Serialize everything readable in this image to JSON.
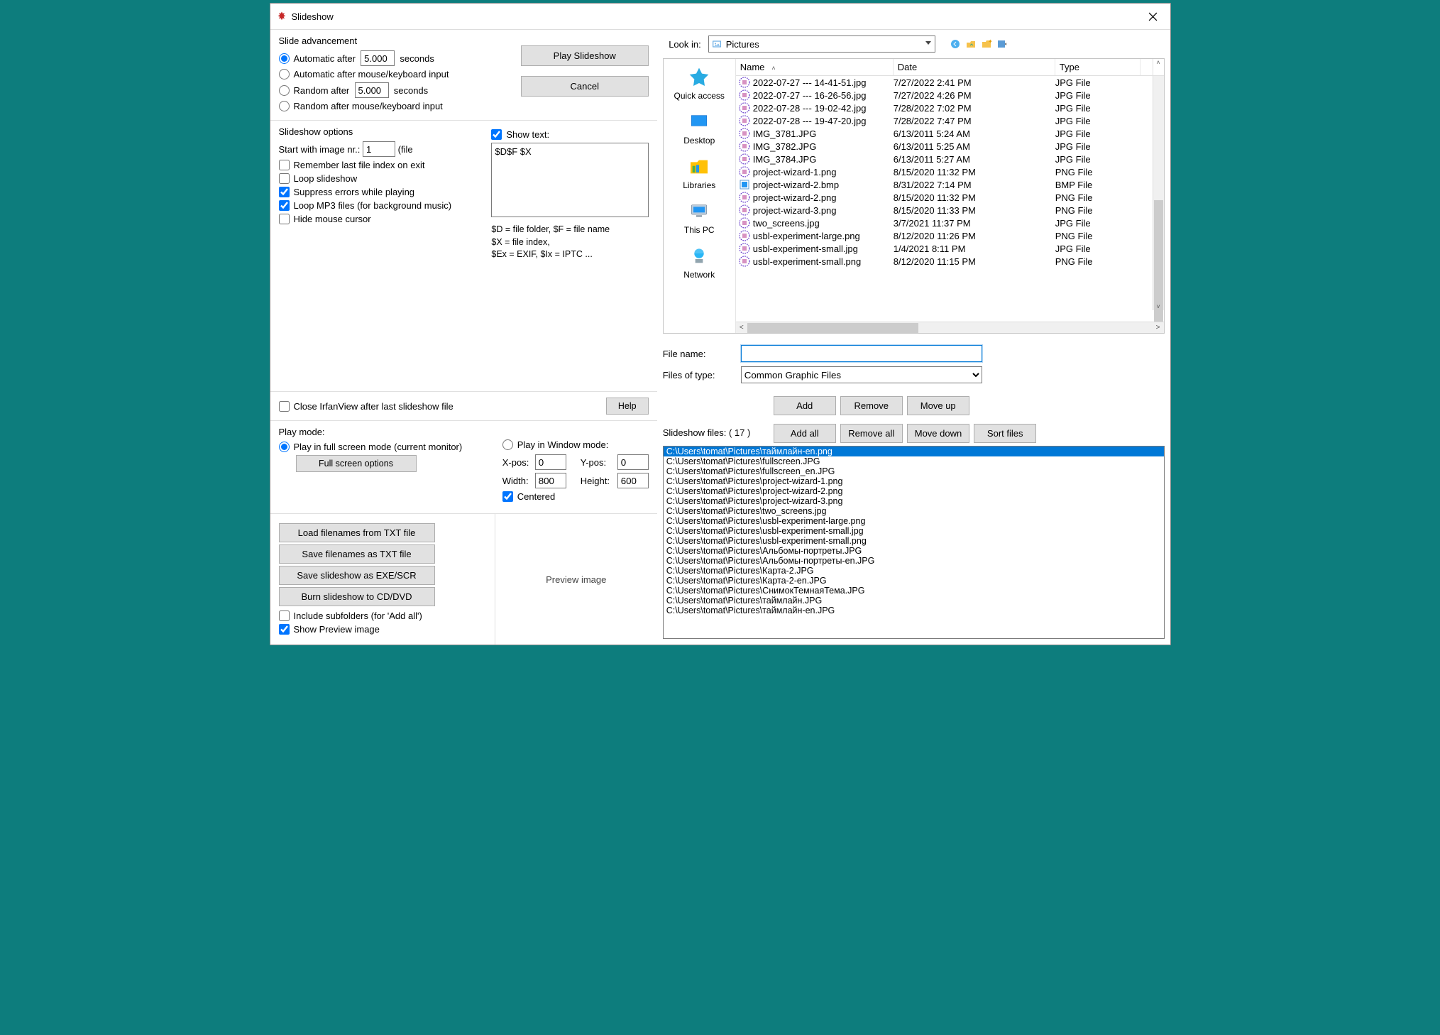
{
  "window_title": "Slideshow",
  "advancement": {
    "title": "Slide advancement",
    "auto_after": "Automatic after",
    "auto_after_sec": "5.000",
    "seconds": "seconds",
    "auto_input": "Automatic after mouse/keyboard input",
    "random_after": "Random   after",
    "random_after_sec": "5.000",
    "random_input": "Random   after mouse/keyboard input"
  },
  "buttons": {
    "play": "Play Slideshow",
    "cancel": "Cancel",
    "help": "Help"
  },
  "options": {
    "title": "Slideshow options",
    "start_nr_label": "Start with image nr.:",
    "start_nr": "1",
    "file_suffix": "(file",
    "remember": "Remember last file index on exit",
    "loop": "Loop slideshow",
    "suppress": "Suppress errors while playing",
    "loop_mp3": "Loop MP3 files (for background music)",
    "hide_cursor": "Hide mouse cursor",
    "show_text": "Show text:",
    "text_pattern": "$D$F $X",
    "hint1": "$D = file folder, $F = file name",
    "hint2": "$X = file index,",
    "hint3": "$Ex = EXIF, $Ix = IPTC ..."
  },
  "close_after": "Close IrfanView after last slideshow file",
  "playmode": {
    "title": "Play mode:",
    "full": "Play in full screen mode (current monitor)",
    "full_btn": "Full screen options",
    "window": "Play in Window mode:",
    "xpos_l": "X-pos:",
    "xpos": "0",
    "ypos_l": "Y-pos:",
    "ypos": "0",
    "width_l": "Width:",
    "width": "800",
    "height_l": "Height:",
    "height": "600",
    "centered": "Centered"
  },
  "fileops": {
    "load_txt": "Load filenames from TXT file",
    "save_txt": "Save filenames as TXT file",
    "save_exe": "Save slideshow as  EXE/SCR",
    "burn": "Burn slideshow to CD/DVD",
    "include_sub": "Include subfolders (for 'Add all')",
    "show_preview": "Show Preview image",
    "preview_label": "Preview image"
  },
  "lookin": {
    "label": "Look in:",
    "value": "Pictures"
  },
  "headers": {
    "name": "Name",
    "date": "Date",
    "type": "Type"
  },
  "files": [
    {
      "name": "2022-07-27 --- 14-41-51.jpg",
      "date": "7/27/2022 2:41 PM",
      "type": "JPG File",
      "ic": "img"
    },
    {
      "name": "2022-07-27 --- 16-26-56.jpg",
      "date": "7/27/2022 4:26 PM",
      "type": "JPG File",
      "ic": "img"
    },
    {
      "name": "2022-07-28 --- 19-02-42.jpg",
      "date": "7/28/2022 7:02 PM",
      "type": "JPG File",
      "ic": "img"
    },
    {
      "name": "2022-07-28 --- 19-47-20.jpg",
      "date": "7/28/2022 7:47 PM",
      "type": "JPG File",
      "ic": "img"
    },
    {
      "name": "IMG_3781.JPG",
      "date": "6/13/2011 5:24 AM",
      "type": "JPG File",
      "ic": "img"
    },
    {
      "name": "IMG_3782.JPG",
      "date": "6/13/2011 5:25 AM",
      "type": "JPG File",
      "ic": "img"
    },
    {
      "name": "IMG_3784.JPG",
      "date": "6/13/2011 5:27 AM",
      "type": "JPG File",
      "ic": "img"
    },
    {
      "name": "project-wizard-1.png",
      "date": "8/15/2020 11:32 PM",
      "type": "PNG File",
      "ic": "img"
    },
    {
      "name": "project-wizard-2.bmp",
      "date": "8/31/2022 7:14 PM",
      "type": "BMP File",
      "ic": "bmp"
    },
    {
      "name": "project-wizard-2.png",
      "date": "8/15/2020 11:32 PM",
      "type": "PNG File",
      "ic": "img"
    },
    {
      "name": "project-wizard-3.png",
      "date": "8/15/2020 11:33 PM",
      "type": "PNG File",
      "ic": "img"
    },
    {
      "name": "two_screens.jpg",
      "date": "3/7/2021 11:37 PM",
      "type": "JPG File",
      "ic": "img"
    },
    {
      "name": "usbl-experiment-large.png",
      "date": "8/12/2020 11:26 PM",
      "type": "PNG File",
      "ic": "img"
    },
    {
      "name": "usbl-experiment-small.jpg",
      "date": "1/4/2021 8:11 PM",
      "type": "JPG File",
      "ic": "img"
    },
    {
      "name": "usbl-experiment-small.png",
      "date": "8/12/2020 11:15 PM",
      "type": "PNG File",
      "ic": "img"
    }
  ],
  "filename_label": "File name:",
  "filename_value": "",
  "filetype_label": "Files of type:",
  "filetype_value": "Common Graphic Files",
  "sfbtn": {
    "add": "Add",
    "remove": "Remove",
    "moveup": "Move up",
    "addall": "Add all",
    "removeall": "Remove all",
    "movedown": "Move down",
    "sort": "Sort files"
  },
  "sf_header": "Slideshow files:  ( 17 )",
  "sf_items": [
    "C:\\Users\\tomat\\Pictures\\таймлайн-en.png",
    "C:\\Users\\tomat\\Pictures\\fullscreen.JPG",
    "C:\\Users\\tomat\\Pictures\\fullscreen_en.JPG",
    "C:\\Users\\tomat\\Pictures\\project-wizard-1.png",
    "C:\\Users\\tomat\\Pictures\\project-wizard-2.png",
    "C:\\Users\\tomat\\Pictures\\project-wizard-3.png",
    "C:\\Users\\tomat\\Pictures\\two_screens.jpg",
    "C:\\Users\\tomat\\Pictures\\usbl-experiment-large.png",
    "C:\\Users\\tomat\\Pictures\\usbl-experiment-small.jpg",
    "C:\\Users\\tomat\\Pictures\\usbl-experiment-small.png",
    "C:\\Users\\tomat\\Pictures\\Альбомы-портреты.JPG",
    "C:\\Users\\tomat\\Pictures\\Альбомы-портреты-en.JPG",
    "C:\\Users\\tomat\\Pictures\\Карта-2.JPG",
    "C:\\Users\\tomat\\Pictures\\Карта-2-en.JPG",
    "C:\\Users\\tomat\\Pictures\\СнимокТемнаяТема.JPG",
    "C:\\Users\\tomat\\Pictures\\таймлайн.JPG",
    "C:\\Users\\tomat\\Pictures\\таймлайн-en.JPG"
  ],
  "places": {
    "quick": "Quick access",
    "desktop": "Desktop",
    "libraries": "Libraries",
    "thispc": "This PC",
    "network": "Network"
  }
}
